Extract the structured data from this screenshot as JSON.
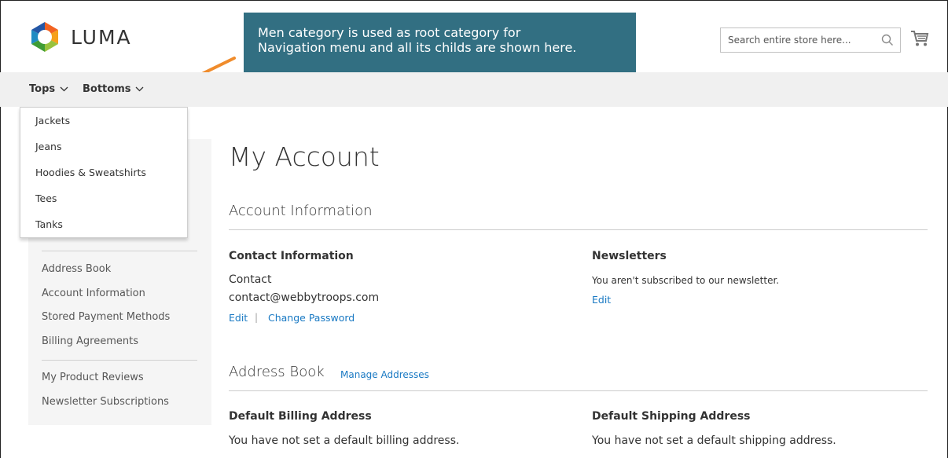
{
  "brand": {
    "logo_text": "LUMA"
  },
  "colors": {
    "link": "#1979c3",
    "callout_bg": "#326f82",
    "arrow": "#f08c2c",
    "nav_bg": "#f0f0f0",
    "sidebar_bg": "#f5f5f5"
  },
  "callout": {
    "line1": "Men category is used as root category for",
    "line2": "Navigation menu and all its childs are shown here."
  },
  "search": {
    "placeholder": "Search entire store here...",
    "icon": "search-icon"
  },
  "cart": {
    "icon": "cart-icon"
  },
  "nav": {
    "items": [
      {
        "label": "Tops"
      },
      {
        "label": "Bottoms"
      }
    ]
  },
  "dropdown": {
    "items": [
      "Jackets",
      "Jeans",
      "Hoodies & Sweatshirts",
      "Tees",
      "Tanks"
    ]
  },
  "sidebar": {
    "group2": [
      "Address Book",
      "Account Information",
      "Stored Payment Methods",
      "Billing Agreements"
    ],
    "group3": [
      "My Product Reviews",
      "Newsletter Subscriptions"
    ]
  },
  "main": {
    "page_title": "My Account",
    "account_info": {
      "title": "Account Information",
      "contact": {
        "title": "Contact Information",
        "name": "Contact",
        "email": "contact@webbytroops.com",
        "edit": "Edit",
        "separator": "|",
        "change_password": "Change Password"
      },
      "newsletters": {
        "title": "Newsletters",
        "text": "You aren't subscribed to our newsletter.",
        "edit": "Edit"
      }
    },
    "address_book": {
      "title": "Address Book",
      "manage": "Manage Addresses",
      "billing": {
        "title": "Default Billing Address",
        "text": "You have not set a default billing address."
      },
      "shipping": {
        "title": "Default Shipping Address",
        "text": "You have not set a default shipping address."
      }
    }
  }
}
